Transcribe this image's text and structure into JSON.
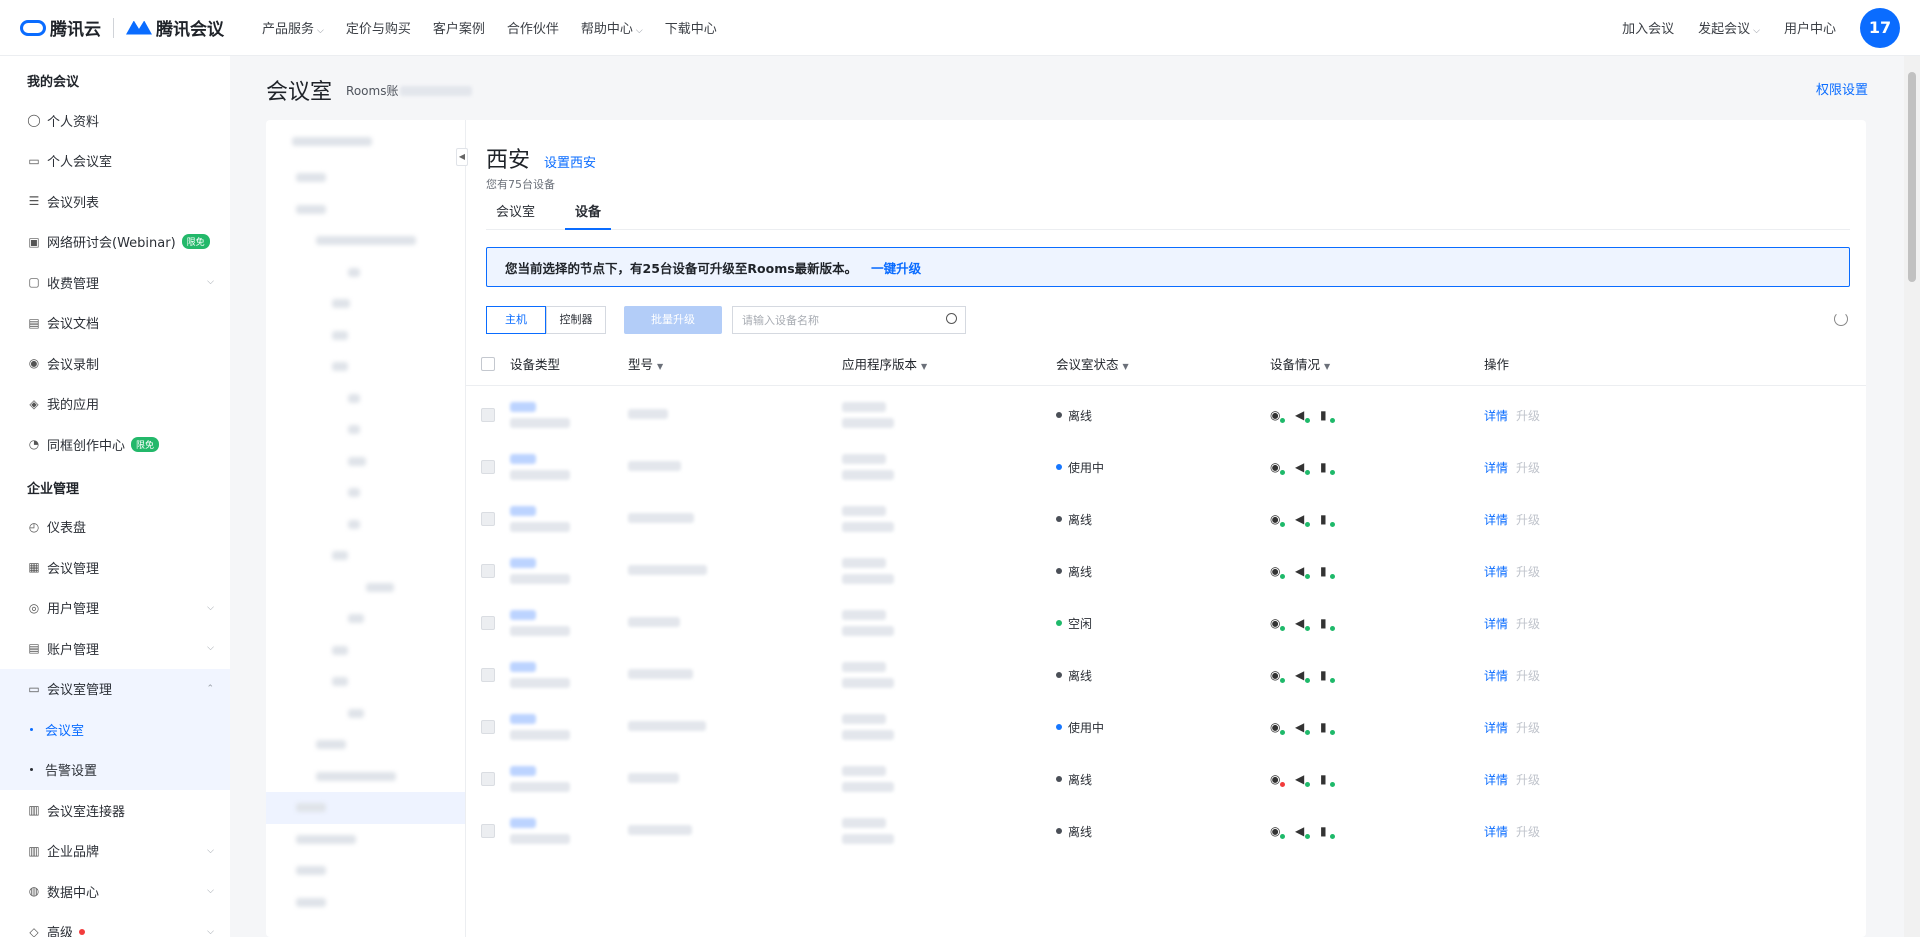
{
  "top": {
    "brand1": "腾讯云",
    "brand2": "腾讯会议",
    "nav": [
      {
        "label": "产品服务",
        "dropdown": true
      },
      {
        "label": "定价与购买",
        "dropdown": false
      },
      {
        "label": "客户案例",
        "dropdown": false
      },
      {
        "label": "合作伙伴",
        "dropdown": false
      },
      {
        "label": "帮助中心",
        "dropdown": true
      },
      {
        "label": "下载中心",
        "dropdown": false
      }
    ],
    "join": "加入会议",
    "start": "发起会议",
    "user_center": "用户中心",
    "avatar": "17"
  },
  "sidebar": {
    "sec1": "我的会议",
    "items1": [
      {
        "label": "个人资料",
        "icon": "user-icon"
      },
      {
        "label": "个人会议室",
        "icon": "screen-icon"
      },
      {
        "label": "会议列表",
        "icon": "list-icon"
      },
      {
        "label": "网络研讨会(Webinar)",
        "icon": "monitor-icon",
        "badge": "限免"
      },
      {
        "label": "收费管理",
        "icon": "bag-icon",
        "chev": true
      },
      {
        "label": "会议文档",
        "icon": "doc-icon"
      },
      {
        "label": "会议录制",
        "icon": "record-icon"
      },
      {
        "label": "我的应用",
        "icon": "layers-icon"
      },
      {
        "label": "同框创作中心",
        "icon": "create-icon",
        "badge": "限免"
      }
    ],
    "sec2": "企业管理",
    "items2": [
      {
        "label": "仪表盘",
        "icon": "gauge-icon"
      },
      {
        "label": "会议管理",
        "icon": "grid-icon"
      },
      {
        "label": "用户管理",
        "icon": "users-icon",
        "chev": true
      },
      {
        "label": "账户管理",
        "icon": "account-icon",
        "chev": true
      },
      {
        "label": "会议室管理",
        "icon": "room-icon",
        "chev": true
      }
    ],
    "sub": [
      "会议室",
      "告警设置"
    ],
    "items3": [
      {
        "label": "会议室连接器",
        "icon": "connector-icon"
      },
      {
        "label": "企业品牌",
        "icon": "building-icon",
        "chev": true
      },
      {
        "label": "数据中心",
        "icon": "data-icon",
        "chev": true
      },
      {
        "label": "高级",
        "icon": "advanced-icon",
        "chev": true
      }
    ]
  },
  "page": {
    "title": "会议室",
    "subtitle": "Rooms账",
    "perm": "权限设置"
  },
  "main": {
    "location": "西安",
    "set_link": "设置西安",
    "count": "您有75台设备",
    "tabs": [
      "会议室",
      "设备"
    ],
    "notice": "您当前选择的节点下，有25台设备可升级至Rooms最新版本。",
    "notice_link": "一键升级",
    "seg": [
      "主机",
      "控制器"
    ],
    "batch": "批量升级",
    "search_ph": "请输入设备名称"
  },
  "table": {
    "headers": [
      "设备类型",
      "型号",
      "应用程序版本",
      "会议室状态",
      "设备情况",
      "操作"
    ],
    "op_detail": "详情",
    "op_upgrade": "升级",
    "rows": [
      {
        "status": "离线",
        "color": "#4a4f57"
      },
      {
        "status": "使用中",
        "color": "#1677ff"
      },
      {
        "status": "离线",
        "color": "#4a4f57"
      },
      {
        "status": "离线",
        "color": "#4a4f57"
      },
      {
        "status": "空闲",
        "color": "#1fb96a"
      },
      {
        "status": "离线",
        "color": "#4a4f57"
      },
      {
        "status": "使用中",
        "color": "#1677ff"
      },
      {
        "status": "离线",
        "color": "#4a4f57",
        "camera_alert": true
      },
      {
        "status": "离线",
        "color": "#4a4f57"
      }
    ]
  }
}
